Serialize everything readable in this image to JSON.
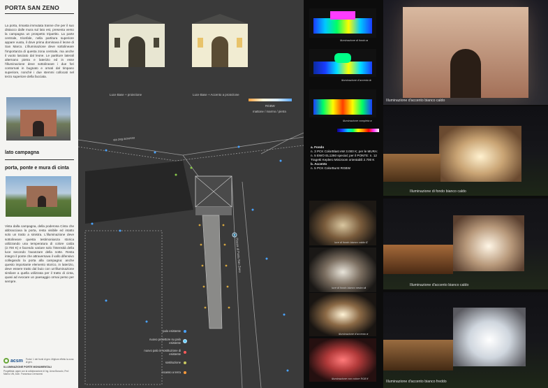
{
  "left": {
    "title": "PORTA SAN ZENO",
    "intro": "La porta, rimasta immutata tranne che per il suo distacco dalle mura sul lato est, presenta verso la campagna un prospetto tripartito. La parte centrale, trionfale, nella partitura superiore appare vuota, il dove prima dominava il leone di San Marco. L'illuminazione deve sottolineare l'importanza di questa zona centrale, ma anche il vuoto lasciato dal leone. Le partiture laterali alternano pietra e laterizio ed in esse l'illuminazione deve sottolineare i due fori contornati in bugnato e ornati dal timpano superiore, nonchè i due stemmi collocati nel terzo superiore della facciata.",
    "section1": "lato campagna",
    "section2": "porta, ponte e mura di cinta",
    "body2": "Vista dalla campagna, della poderosa Cinta che abbracciava la porta, resta visibile ed intatto solo un tratto a sinistra. L'illuminazione deve sottolineare questa testimonianza storica utilizzando una temperatura di colore calda (2.700 K) e facendo variare solo l'intensità della luce secondo l'avanzare della notte. Resta integro il ponte che attraversava il vallo difensivo collegando la porta alla campagna: anche questo importante elemento storico, in laterizio, deve essere tratto dal buio con un'illuminazione similare a quella utilizzata per il tratto di cinta, quasi ad evocare un paesaggio ormai perso per sempre.",
    "logo": "acsm",
    "footer_small": "Porta I 1 dei fronti di gen. Migliore effetto la zona di gen.",
    "footer_title": "ILLUMINAZIONE PORTE MONUMENTALI",
    "footer_credit": "Progettista: agsm con la collaborazione di Ing. Anna Boscolo, Prof. Marino Viti, Arch. Francesca Cremonesi"
  },
  "map": {
    "caption_a": "Luce Base + proiezione",
    "caption_b": "Luce Base + Accento a proiezione",
    "scale_title": "RGBW",
    "scale_sub": "mattone / marmo / pietra",
    "street1": "via zeg accesso",
    "street2": "Piazza di Porta San Zeno",
    "legend": [
      {
        "label": "palo esistente",
        "color": "#4aa3ff"
      },
      {
        "label": "nuovo proiettore su palo esistente",
        "color": "#6bd0ff"
      },
      {
        "label": "nuovo palo in sostituzione di esistente",
        "color": "#ff5a5a"
      },
      {
        "label": "sostituzione",
        "color": "#c8c860"
      },
      {
        "label": "incasso a terra",
        "color": "#ff9a3a"
      }
    ]
  },
  "right": {
    "false_captions": [
      {
        "text": "illuminazione di fondo",
        "letter": "a"
      },
      {
        "text": "illuminazione d'accento",
        "letter": "b"
      },
      {
        "text": "illuminazione completa",
        "letter": "c"
      }
    ],
    "spec_a_title": "a. Fondo",
    "spec_a": "n. 3 PCK ColorBlast eW 3.000 K; per le MURA: n. 5 EWO EL1260 special; per il PONTE: n. 12 Tragetti Keplero Minizoom orientabili 2.700 K",
    "spec_b_title": "b. Accento",
    "spec_b": "n. 5 PCK ColorBurst RGBW",
    "thumb_captions": [
      {
        "text": "luce di fondo bianco caldo",
        "letter": "C"
      },
      {
        "text": "luce di fondo bianco neutro",
        "letter": "d"
      },
      {
        "text": "illuminazione d'accento",
        "letter": "e"
      },
      {
        "text": "illuminazione con colore RGB",
        "letter": "f"
      }
    ],
    "render_captions": [
      "Illuminazione d'accento bianco caldo",
      "Illuminazione di fondo bianco caldo",
      "Illuminazione d'accento bianco caldo",
      "Illuminazione d'accento bianco freddo"
    ]
  }
}
